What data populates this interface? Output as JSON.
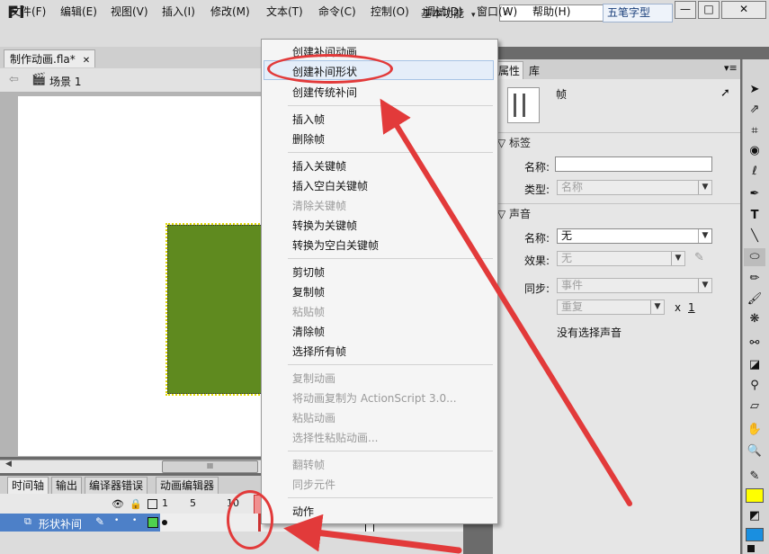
{
  "app": {
    "logo": "Fl",
    "workspace": "基本功能",
    "workspace_arrow": "▾",
    "search_value": "",
    "ime_label": "五笔字型",
    "window_buttons": [
      "—",
      "□",
      "✕"
    ]
  },
  "menubar": [
    "文件(F)",
    "编辑(E)",
    "视图(V)",
    "插入(I)",
    "修改(M)",
    "文本(T)",
    "命令(C)",
    "控制(O)",
    "调试(D)",
    "窗口(W)",
    "帮助(H)"
  ],
  "document": {
    "tab": "制作动画.fla*",
    "scene": "场景 1",
    "scroll_thumb": "III"
  },
  "timeline": {
    "tabs": [
      "时间轴",
      "输出",
      "编译器错误",
      "动画编辑器"
    ],
    "frame_numbers": [
      "1",
      "5",
      "10"
    ],
    "layer_name": "形状补间"
  },
  "properties": {
    "tabs": [
      "属性",
      "库"
    ],
    "frame_label": "帧",
    "label_section": "标签",
    "name_label": "名称:",
    "name_value": "",
    "type_label": "类型:",
    "type_value": "名称",
    "sound_section": "声音",
    "sound_name_label": "名称:",
    "sound_name_value": "无",
    "effect_label": "效果:",
    "effect_value": "无",
    "sync_label": "同步:",
    "sync_value": "事件",
    "repeat_value": "重复",
    "repeat_x": "x",
    "repeat_count": "1",
    "no_sound": "没有选择声音"
  },
  "context_menu": {
    "groups": [
      [
        {
          "label": "创建补间动画",
          "enabled": true
        },
        {
          "label": "创建补间形状",
          "enabled": true,
          "highlighted": true
        },
        {
          "label": "创建传统补间",
          "enabled": true
        }
      ],
      [
        {
          "label": "插入帧",
          "enabled": true
        },
        {
          "label": "删除帧",
          "enabled": true
        }
      ],
      [
        {
          "label": "插入关键帧",
          "enabled": true
        },
        {
          "label": "插入空白关键帧",
          "enabled": true
        },
        {
          "label": "清除关键帧",
          "enabled": false
        },
        {
          "label": "转换为关键帧",
          "enabled": true
        },
        {
          "label": "转换为空白关键帧",
          "enabled": true
        }
      ],
      [
        {
          "label": "剪切帧",
          "enabled": true
        },
        {
          "label": "复制帧",
          "enabled": true
        },
        {
          "label": "粘贴帧",
          "enabled": false
        },
        {
          "label": "清除帧",
          "enabled": true
        },
        {
          "label": "选择所有帧",
          "enabled": true
        }
      ],
      [
        {
          "label": "复制动画",
          "enabled": false
        },
        {
          "label": "将动画复制为 ActionScript 3.0...",
          "enabled": false
        },
        {
          "label": "粘贴动画",
          "enabled": false
        },
        {
          "label": "选择性粘贴动画...",
          "enabled": false
        }
      ],
      [
        {
          "label": "翻转帧",
          "enabled": false
        },
        {
          "label": "同步元件",
          "enabled": false
        }
      ],
      [
        {
          "label": "动作",
          "enabled": true
        }
      ]
    ]
  },
  "colors": {
    "annotation": "#e23a3a",
    "shape_fill": "#5f8a1f",
    "layer_selected": "#4d80c8"
  }
}
